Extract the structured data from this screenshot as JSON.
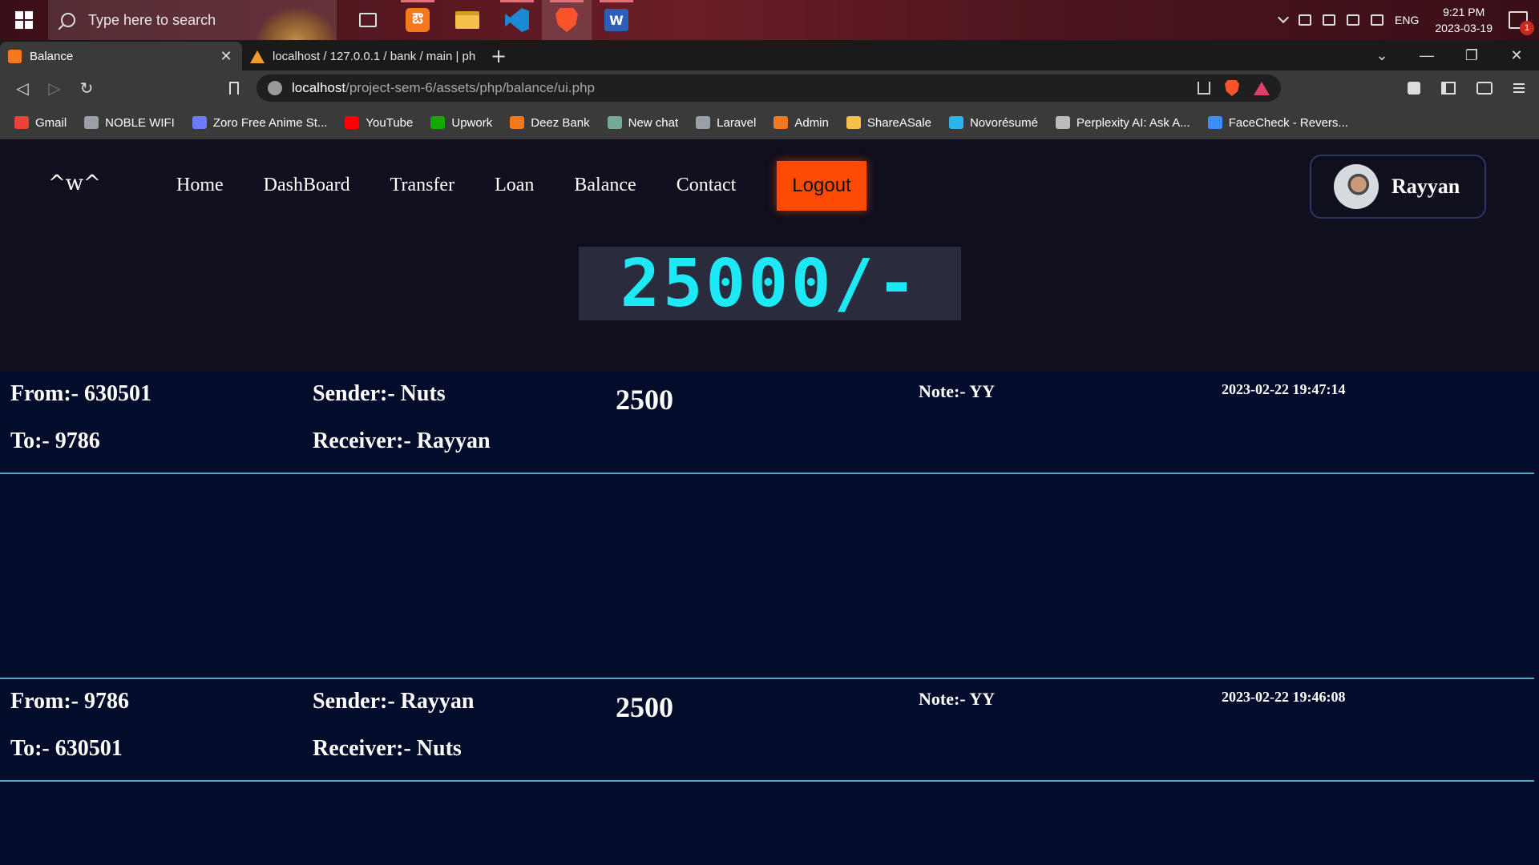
{
  "taskbar": {
    "search_placeholder": "Type here to search",
    "apps": [
      "task-view",
      "xampp",
      "file-explorer",
      "vscode",
      "brave",
      "word"
    ],
    "tray": {
      "language": "ENG",
      "time": "9:21 PM",
      "date": "2023-03-19",
      "notification_count": "1"
    }
  },
  "browser": {
    "tabs": [
      {
        "title": "Balance",
        "active": true
      },
      {
        "title": "localhost / 127.0.0.1 / bank / main | ph",
        "active": false
      }
    ],
    "new_tab_symbol": "+",
    "address": {
      "host": "localhost",
      "path": "/project-sem-6/assets/php/balance/ui.php"
    },
    "bookmarks": [
      {
        "label": "Gmail",
        "color": "#ea4335"
      },
      {
        "label": "NOBLE WIFI",
        "color": "#9aa0a6"
      },
      {
        "label": "Zoro Free Anime St...",
        "color": "#6b7cff"
      },
      {
        "label": "YouTube",
        "color": "#ff0000"
      },
      {
        "label": "Upwork",
        "color": "#14a800"
      },
      {
        "label": "Deez Bank",
        "color": "#f5781f"
      },
      {
        "label": "New chat",
        "color": "#74aa9c"
      },
      {
        "label": "Laravel",
        "color": "#9aa0a6"
      },
      {
        "label": "Admin",
        "color": "#f5781f"
      },
      {
        "label": "ShareASale",
        "color": "#f5c04a"
      },
      {
        "label": "Novorésumé",
        "color": "#2fb4e9"
      },
      {
        "label": "Perplexity AI: Ask A...",
        "color": "#bbbbbb"
      },
      {
        "label": "FaceCheck - Revers...",
        "color": "#3c8dff"
      }
    ]
  },
  "site": {
    "logo": "^w^",
    "nav": [
      "Home",
      "DashBoard",
      "Transfer",
      "Loan",
      "Balance",
      "Contact"
    ],
    "logout_label": "Logout",
    "user_name": "Rayyan",
    "balance": "25000/-",
    "transactions": [
      {
        "from": "From:- 630501",
        "to": "To:- 9786",
        "sender": "Sender:- Nuts",
        "receiver": "Receiver:- Rayyan",
        "amount": "2500",
        "note": "Note:- YY",
        "datetime": "2023-02-22 19:47:14"
      },
      {
        "from": "From:- 9786",
        "to": "To:- 630501",
        "sender": "Sender:- Rayyan",
        "receiver": "Receiver:- Nuts",
        "amount": "2500",
        "note": "Note:- YY",
        "datetime": "2023-02-22 19:46:08"
      }
    ]
  },
  "colors": {
    "accent_cyan": "#1de9f5",
    "logout_orange": "#fd4a05",
    "page_bg": "#030d2b",
    "header_bg": "#100f1d"
  }
}
